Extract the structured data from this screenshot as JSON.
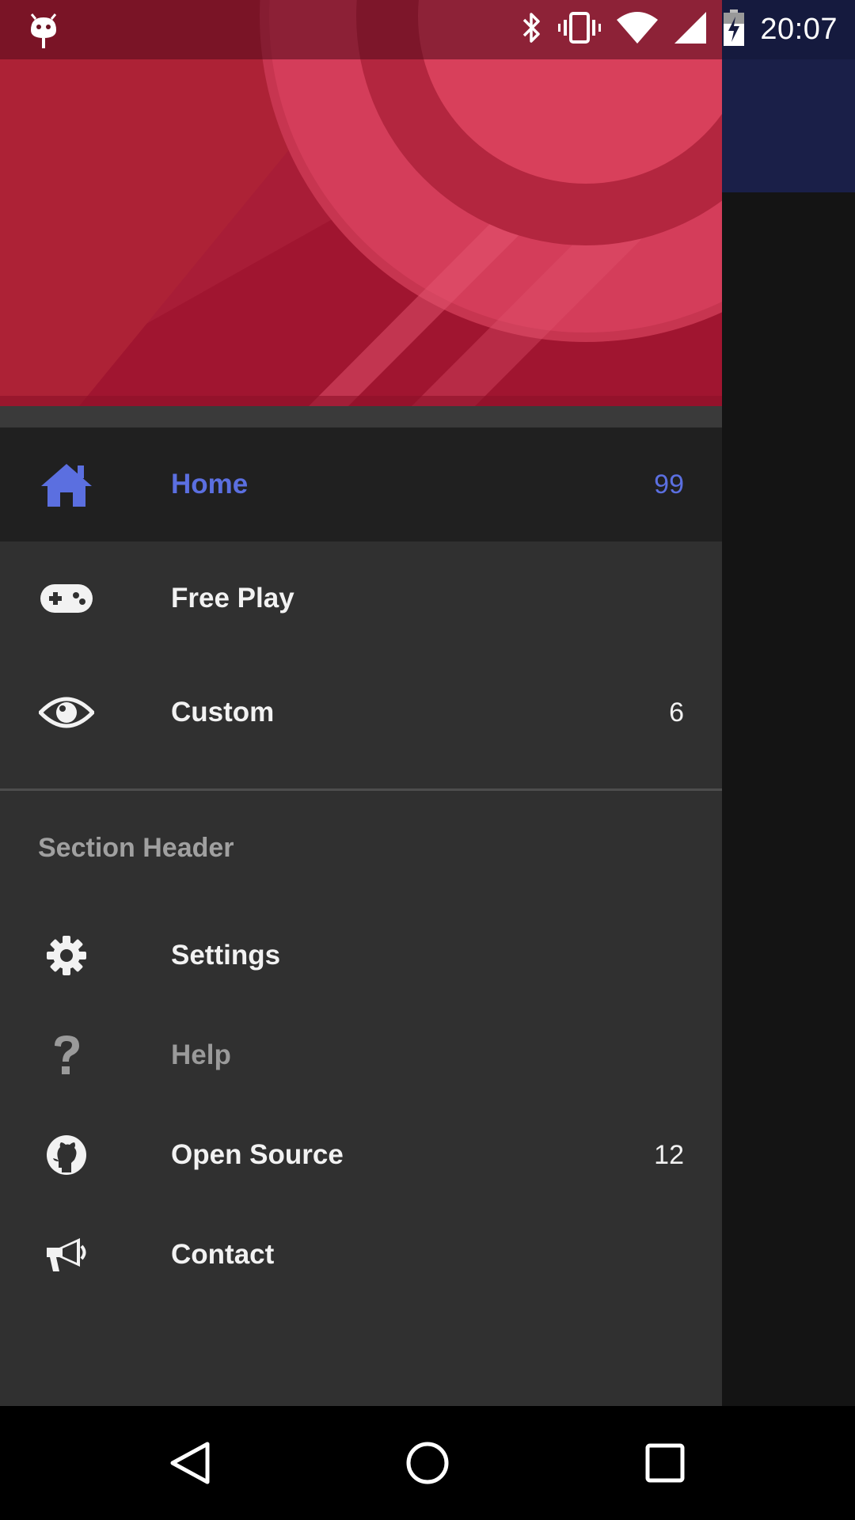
{
  "status_bar": {
    "time": "20:07",
    "icons": [
      "android-debug-icon",
      "bluetooth-icon",
      "vibrate-icon",
      "wifi-icon",
      "cell-signal-icon",
      "battery-charging-icon"
    ]
  },
  "drawer": {
    "primary_items": [
      {
        "icon": "home-icon",
        "label": "Home",
        "badge": "99",
        "selected": true
      },
      {
        "icon": "gamepad-icon",
        "label": "Free Play",
        "badge": "",
        "selected": false
      },
      {
        "icon": "eye-icon",
        "label": "Custom",
        "badge": "6",
        "selected": false
      }
    ],
    "section_header": "Section Header",
    "secondary_items": [
      {
        "icon": "gear-icon",
        "label": "Settings",
        "badge": "",
        "enabled": true
      },
      {
        "icon": "question-icon",
        "label": "Help",
        "badge": "",
        "enabled": false
      },
      {
        "icon": "github-icon",
        "label": "Open Source",
        "badge": "12",
        "enabled": true
      },
      {
        "icon": "bullhorn-icon",
        "label": "Contact",
        "badge": "",
        "enabled": true
      }
    ]
  },
  "nav_bar": {
    "buttons": [
      "back-icon",
      "home-circle-icon",
      "recents-icon"
    ]
  },
  "colors": {
    "accent": "#5b6fe0",
    "drawer_bg": "#303030",
    "selected_bg": "#202020",
    "header_red": "#a3172e",
    "toolbar_navy": "#1a1f48"
  }
}
